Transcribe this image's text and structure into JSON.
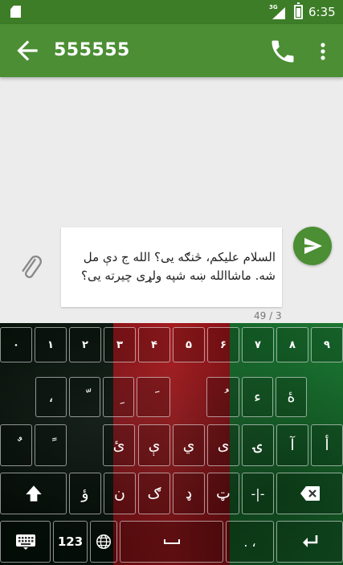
{
  "status_bar": {
    "time": "6:35",
    "network_label": "3G",
    "icons": [
      "sd-card-icon",
      "signal-icon",
      "battery-icon"
    ]
  },
  "app_bar": {
    "title": "555555",
    "back_icon": "arrow-back-icon",
    "call_icon": "phone-icon",
    "more_icon": "more-vert-icon"
  },
  "compose": {
    "message_line_1": "السلام علیکم، څنګه یی؟ الله ج دې مل",
    "message_line_2": "شه. ماشاالله ښه شپه ولړی چیرته یی؟",
    "counter": "49 / 3",
    "attach_icon": "paperclip-icon",
    "send_icon": "send-icon"
  },
  "keyboard": {
    "digits": [
      "۰",
      "۱",
      "۲",
      "۳",
      "۴",
      "۵",
      "۶",
      "۷",
      "۸",
      "۹"
    ],
    "row2": [
      "،",
      "ّ",
      "ِ",
      "َ",
      "ُ",
      "ء",
      "ۀ"
    ],
    "row3": [
      "ٌ",
      "ً",
      "ئ",
      "ې",
      "ي",
      "ی",
      "ۍ",
      "آ",
      "أ"
    ],
    "row4": [
      "ؤ",
      "ن",
      "ګ",
      "ډ",
      "ټ",
      "-|-"
    ],
    "shift_icon": "shift-icon",
    "delete_icon": "backspace-icon",
    "keyboard_icon": "keyboard-icon",
    "numbers_label": "123",
    "globe_icon": "globe-icon",
    "punct_label": ". ،",
    "enter_icon": "enter-icon",
    "flag_colors": [
      "#0b1a10",
      "#c01e22",
      "#1f8a3a"
    ]
  }
}
